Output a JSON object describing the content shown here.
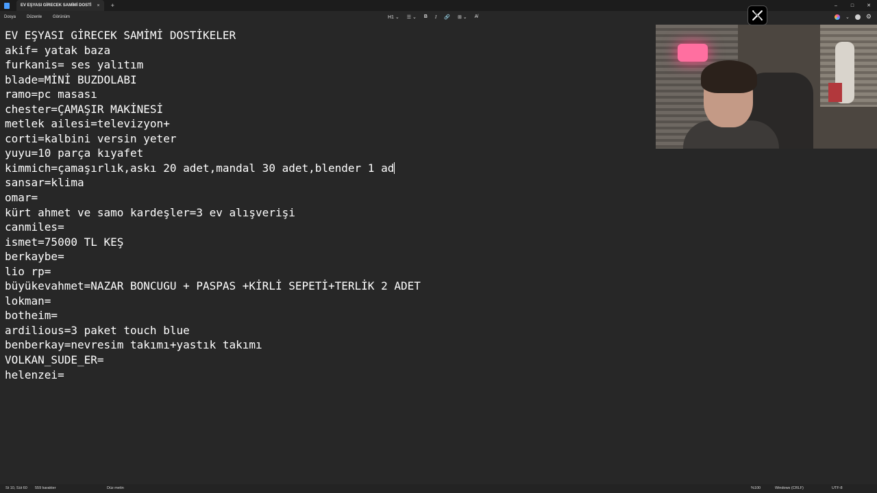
{
  "window": {
    "tab_title": "EV EŞYASI GİRECEK SAMİMİ DOSTİ",
    "tab_close": "×",
    "new_tab": "+",
    "controls": {
      "minimize": "–",
      "maximize": "□",
      "close": "✕"
    }
  },
  "menu": {
    "items": [
      "Dosya",
      "Düzenle",
      "Görünüm"
    ]
  },
  "toolbar": {
    "heading": "H1 ⌄",
    "list": "☰ ⌄",
    "bold": "B",
    "italic": "I",
    "link": "🔗",
    "table": "⊞ ⌄",
    "clear_format": "A̸",
    "more": "⌄",
    "settings": "⚙"
  },
  "document": {
    "lines": [
      "EV EŞYASI GİRECEK SAMİMİ DOSTİKELER",
      "akif= yatak baza",
      "furkanis= ses yalıtım",
      "blade=MİNİ BUZDOLABI",
      "ramo=pc masası",
      "chester=ÇAMAŞIR MAKİNESİ",
      "metlek ailesi=televizyon+",
      "corti=kalbini versin yeter",
      "yuyu=10 parça kıyafet",
      "kimmich=çamaşırlık,askı 20 adet,mandal 30 adet,blender 1 ad",
      "sansar=klima",
      "omar=",
      "kürt ahmet ve samo kardeşler=3 ev alışverişi",
      "canmiles=",
      "ismet=75000 TL KEŞ",
      "berkaybe=",
      "lio rp=",
      "büyükevahmet=NAZAR BONCUGU + PASPAS +KİRLİ SEPETİ+TERLİK 2 ADET",
      "lokman=",
      "botheim=",
      "ardilious=3 paket touch blue",
      "benberkay=nevresim takımı+yastık takımı",
      "VOLKAN_SUDE_ER=",
      "helenzei="
    ],
    "caret_line": 9
  },
  "status": {
    "position": "St 10, Süt 60",
    "char_count": "559 karakter",
    "format": "Düz metin",
    "zoom": "%100",
    "line_ending": "Windows (CRLF)",
    "encoding": "UTF-8"
  },
  "overlay": {
    "x_logo": "𝕏"
  },
  "colors": {
    "background": "#272727",
    "text": "#ffffff",
    "titlebar": "#1c1c1c"
  }
}
